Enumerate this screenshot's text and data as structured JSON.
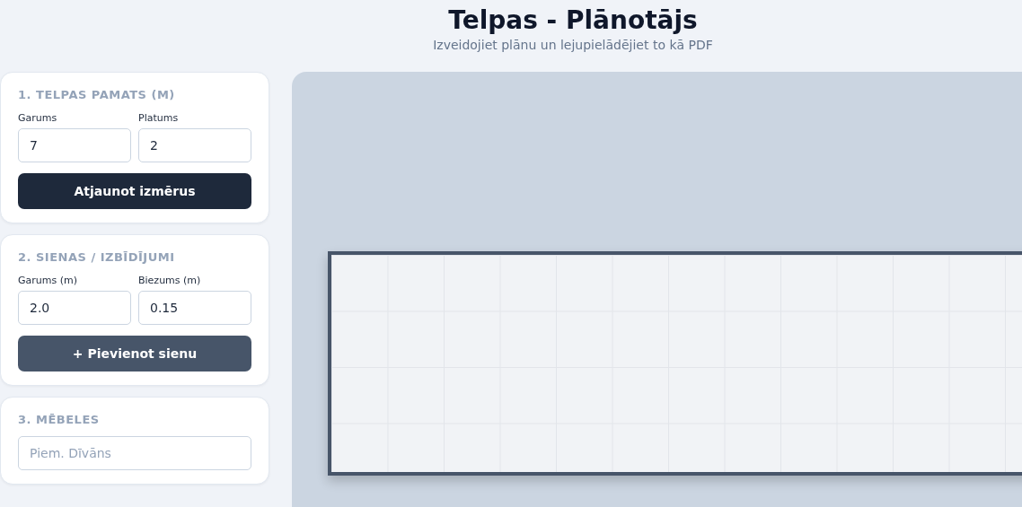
{
  "header": {
    "title": "Telpas - Plānotājs",
    "subtitle": "Izveidojiet plānu un lejupielādējiet to kā PDF"
  },
  "panels": [
    {
      "heading": "1. TELPAS PAMATS (M)",
      "fields": [
        {
          "label": "Garums",
          "value": "7"
        },
        {
          "label": "Platums",
          "value": "2"
        }
      ],
      "button": {
        "label": "Atjaunot izmērus",
        "kind": "primary"
      }
    },
    {
      "heading": "2. SIENAS / IZBĪDĪJUMI",
      "fields": [
        {
          "label": "Garums (m)",
          "value": "2.0"
        },
        {
          "label": "Biezums (m)",
          "value": "0.15"
        }
      ],
      "button": {
        "label": "+ Pievienot sienu",
        "kind": "secondary"
      }
    },
    {
      "heading": "3. MĒBELES",
      "fields": [
        {
          "placeholder": "Piem. Dīvāns"
        }
      ]
    }
  ]
}
